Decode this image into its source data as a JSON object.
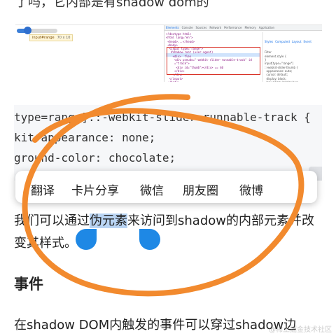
{
  "article": {
    "top_text": "了吗，它内部是有shadow dom的",
    "paragraph1_before": "我们可以通过",
    "paragraph1_selected": "伪元素",
    "paragraph1_after": "来访问到shadow的内部元素并改变其样式。",
    "section_heading": "事件",
    "paragraph2": "在shadow DOM内触发的事件可以穿过shadow边"
  },
  "devtools_screenshot": {
    "slider_value": 0.25,
    "tooltip_label": "input#range",
    "tooltip_size": "70 x 10",
    "tabs": [
      "Elements",
      "Console",
      "Sources",
      "Network",
      "Performance",
      "Memory",
      "Application"
    ],
    "active_tab": "Elements",
    "code_lines": [
      "<!doctype html>",
      "<html lang=\"en\">",
      " <head>...</head>",
      " <body>",
      "  <input type=\"range\">",
      "   #shadow-root (user-agent)",
      "    <div>  flex",
      "     <div pseudo=\"-webkit-slider-runnable-track\" id",
      "     =\"track\">",
      "      <div id=\"thumb\"></div> == $0",
      "     </div>",
      "    </div>",
      "  </input>",
      " </body>",
      "</html>"
    ],
    "style_tabs": [
      "Styles",
      "Computed",
      "Layout",
      "Event"
    ],
    "styles_lines": [
      "Filter",
      "element.style {",
      "}",
      "input[type=\"range\"]",
      "::-webkit-slider-thumb {",
      "  appearance: auto;",
      "  cursor: default;",
      "  display: block;",
      "  box-sizing: border-box;",
      "  -webkit-user-modify:",
      "    read-only;",
      "}"
    ]
  },
  "code_block": {
    "line1": "type=range]::-webkit-slider-runnable-track {",
    "line2": "kit-appearance: none;",
    "line3": "ground-color: chocolate;"
  },
  "selection_toolbar": {
    "items": [
      "翻译",
      "卡片分享",
      "微信",
      "朋友圈",
      "微博"
    ]
  },
  "watermark": "@稀土掘金技术社区",
  "colors": {
    "scribble": "#f28a2e",
    "selection_highlight": "#b9d4f3",
    "handle": "#1e88e5"
  }
}
